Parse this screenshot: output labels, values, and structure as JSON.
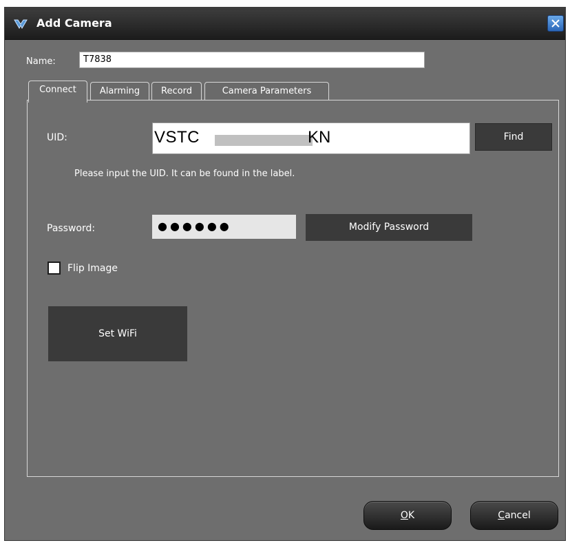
{
  "window": {
    "title": "Add Camera",
    "icon": "camera-app-icon",
    "close_icon": "close-icon"
  },
  "name_field": {
    "label": "Name:",
    "value": "T7838"
  },
  "tabs": [
    {
      "label": "Connect",
      "active": true
    },
    {
      "label": "Alarming",
      "active": false
    },
    {
      "label": "Record",
      "active": false
    },
    {
      "label": "Camera Parameters",
      "active": false
    }
  ],
  "connect": {
    "uid_label": "UID:",
    "uid_value_start": "VSTC",
    "uid_value_end": "KN",
    "find_label": "Find",
    "uid_hint": "Please input the UID. It can be found in the label.",
    "password_label": "Password:",
    "password_mask": "●●●●●●",
    "modify_password_label": "Modify Password",
    "flip_image_label": "Flip Image",
    "flip_image_checked": false,
    "set_wifi_label": "Set WiFi"
  },
  "footer": {
    "ok_mnemonic": "O",
    "ok_rest": "K",
    "cancel_mnemonic": "C",
    "cancel_rest": "ancel"
  },
  "colors": {
    "dialog_bg": "#6e6e6e",
    "titlebar": "#2a2a2a",
    "button_dark": "#3a3a3a",
    "text": "#ffffff"
  }
}
